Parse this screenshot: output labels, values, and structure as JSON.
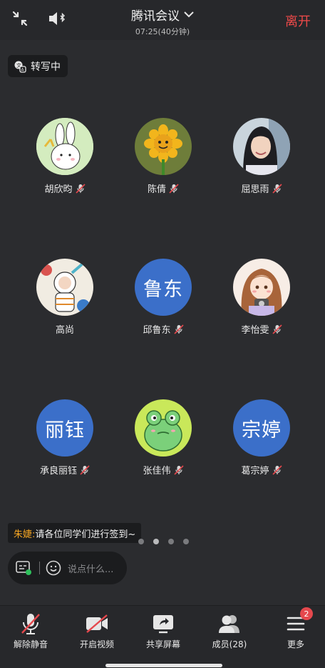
{
  "header": {
    "title": "腾讯会议",
    "duration": "07:25(40分钟)",
    "leave_label": "离开",
    "left_icons": [
      "collapse-icon",
      "speaker-bluetooth-icon"
    ],
    "leave_color": "#f04a4a"
  },
  "transcribe": {
    "label": "转写中"
  },
  "participants": [
    {
      "name": "胡欣昀",
      "avatar_type": "image",
      "avatar_desc": "rabbit",
      "muted": true
    },
    {
      "name": "陈倩",
      "avatar_type": "image",
      "avatar_desc": "sunflower",
      "muted": true
    },
    {
      "name": "屈思雨",
      "avatar_type": "image",
      "avatar_desc": "photo",
      "muted": true
    },
    {
      "name": "高尚",
      "avatar_type": "image",
      "avatar_desc": "astronaut",
      "muted": false
    },
    {
      "name": "邱鲁东",
      "avatar_type": "text",
      "avatar_text": "鲁东",
      "muted": true
    },
    {
      "name": "李怡雯",
      "avatar_type": "image",
      "avatar_desc": "cartoon-girl",
      "muted": true
    },
    {
      "name": "承良丽钰",
      "avatar_type": "text",
      "avatar_text": "丽钰",
      "muted": true
    },
    {
      "name": "张佳伟",
      "avatar_type": "image",
      "avatar_desc": "frog",
      "muted": true
    },
    {
      "name": "葛宗婷",
      "avatar_type": "text",
      "avatar_text": "宗婷",
      "muted": true
    }
  ],
  "chat": {
    "sender": "朱婕:",
    "message": "请各位同学们进行签到~",
    "input_placeholder": "说点什么..."
  },
  "pager": {
    "total": 4,
    "active": 1
  },
  "toolbar": [
    {
      "label": "解除静音",
      "icon": "mic-muted-icon"
    },
    {
      "label": "开启视频",
      "icon": "video-off-icon"
    },
    {
      "label": "共享屏幕",
      "icon": "share-screen-icon"
    },
    {
      "label": "成员(28)",
      "icon": "members-icon"
    },
    {
      "label": "更多",
      "icon": "more-menu-icon",
      "badge": "2"
    }
  ],
  "colors": {
    "accent_text_avatar": "#3b6fc9",
    "muted_red": "#e5484d",
    "sender": "#f5a623"
  }
}
